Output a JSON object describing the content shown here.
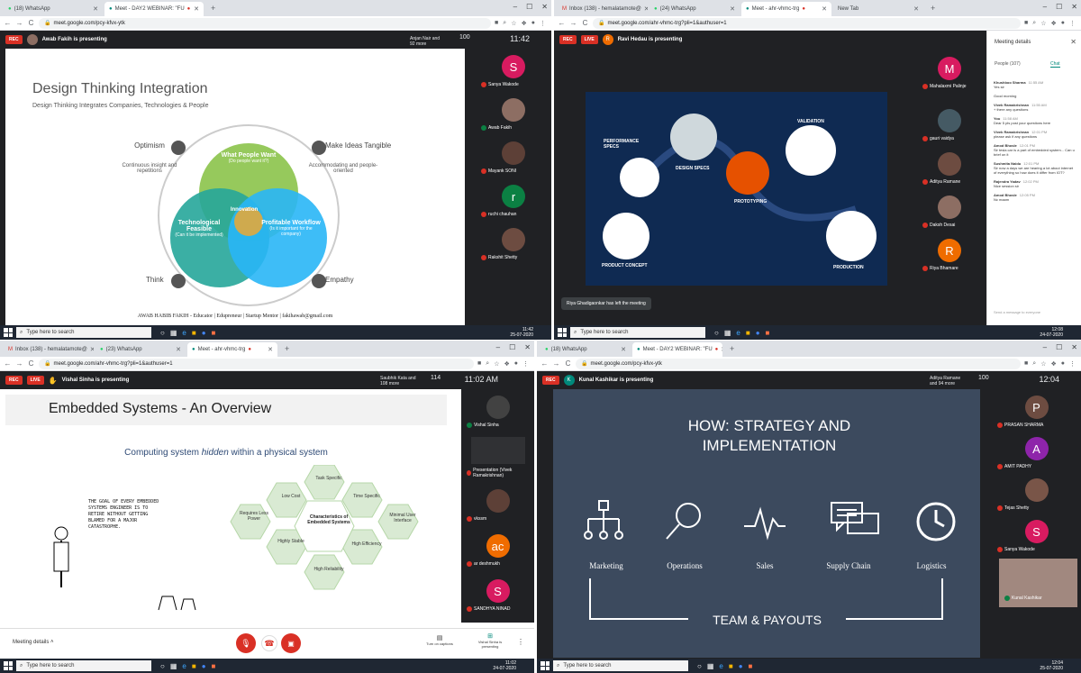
{
  "q1": {
    "tabs": [
      {
        "label": "(18) WhatsApp"
      },
      {
        "label": "Meet - DAY2 WEBINAR: \"FU"
      }
    ],
    "url": "meet.google.com/pcy-kfvx-ytk",
    "rec": "REC",
    "presenter": "Awab Fakih is presenting",
    "people": "Anjan Nair and 92 more",
    "count": "100",
    "time": "11:42",
    "you": "You",
    "slide": {
      "title": "Design Thinking Integration",
      "subtitle": "Design Thinking Integrates Companies, Technologies & People",
      "what": "What People Want",
      "what_sub": "(Do people want it?)",
      "tech": "Technological Feasible",
      "tech_sub": "(Can it be implemented)",
      "profit": "Profitable Workflow",
      "profit_sub": "(Is it important for the company)",
      "innov": "Innovation",
      "optimism": "Optimism",
      "optimism_sub": "Continuous insight and repetitions",
      "tangible": "Make Ideas Tangible",
      "tangible_sub": "Accommodating and people-oriented",
      "think": "Think",
      "empathy": "Empathy",
      "footer": "AWAB HABIB FAKIH - Educator | Edupreneur | Startup Mentor | fakihawab@gmail.com"
    },
    "participants": [
      {
        "name": "Sanya Wakode",
        "initial": "S",
        "color": "#d81b60"
      },
      {
        "name": "Awab Fakih",
        "initial": "",
        "color": "#8d6e63"
      },
      {
        "name": "Mayank SONI",
        "initial": "",
        "color": "#5d4037"
      },
      {
        "name": "ruchi chauhan",
        "initial": "r",
        "color": "#0b8043"
      },
      {
        "name": "Rakshit Shetty",
        "initial": "",
        "color": "#6d4c41"
      }
    ],
    "taskbar": {
      "search": "Type here to search",
      "time": "11:42",
      "date": "25-07-2020"
    }
  },
  "q2": {
    "tabs": [
      {
        "label": "Inbox (138) - hemalatamote@"
      },
      {
        "label": "(24) WhatsApp"
      },
      {
        "label": "Meet - ahr-vhmc-trg"
      },
      {
        "label": "New Tab"
      }
    ],
    "url": "meet.google.com/ahr-vhmc-trg?pli=1&authuser=1",
    "rec": "REC",
    "live": "LIVE",
    "presenter": "Ravi Hedau is presenting",
    "infographic": {
      "perf": "PERFORMANCE SPECS",
      "design": "DESIGN SPECS",
      "valid": "VALIDATION",
      "proto": "PROTOTYPING",
      "product": "PRODUCT CONCEPT",
      "production": "PRODUCTION"
    },
    "left_notice": "Riya Ghadigaonkar has left the meeting",
    "participants": [
      {
        "name": "Mahalaxmi Palinje",
        "initial": "M",
        "color": "#d81b60"
      },
      {
        "name": "gauri vaidya",
        "initial": "",
        "color": "#455a64"
      },
      {
        "name": "Aditya Ramane",
        "initial": "",
        "color": "#6d4c41"
      },
      {
        "name": "Daksh Desai",
        "initial": "",
        "color": "#8d6e63"
      },
      {
        "name": "Riya Bhamare",
        "initial": "R",
        "color": "#ef6c00"
      }
    ],
    "panel": {
      "title": "Meeting details",
      "people_tab": "People (107)",
      "chat_tab": "Chat",
      "messages": [
        {
          "who": "Khushboo Sharma",
          "time": "11:55 AM",
          "text": "Yes sir"
        },
        {
          "who": "",
          "time": "",
          "text": "Good morning"
        },
        {
          "who": "Vivek Ramakrishnan",
          "time": "11:55 AM",
          "text": "+ there any questions"
        },
        {
          "who": "You",
          "time": "11:58 AM",
          "text": "Dear 5 pls post your questions here"
        },
        {
          "who": "Vivek Ramakrishnan",
          "time": "12:01 PM",
          "text": "please ask if any questions"
        },
        {
          "who": "Amod Bhosle",
          "time": "12:01 PM",
          "text": "Sir tesla car is a part of embedded system... Can u brief on it"
        },
        {
          "who": "Sushmita Naidu",
          "time": "12:01 PM",
          "text": "Sir now a days we are hearing a lot about internet of everything so how does it differ from IOT?"
        },
        {
          "who": "Rajendra Yadav",
          "time": "12:02 PM",
          "text": "Nice session sir"
        },
        {
          "who": "Amod Bhosle",
          "time": "12:05 PM",
          "text": "Nc maam"
        }
      ],
      "input": "Send a message to everyone"
    },
    "taskbar": {
      "search": "Type here to search",
      "time": "12:08",
      "date": "24-07-2020"
    }
  },
  "q3": {
    "tabs": [
      {
        "label": "Inbox (138) - hemalatamote@"
      },
      {
        "label": "(23) WhatsApp"
      },
      {
        "label": "Meet - ahr-vhmc-trg"
      }
    ],
    "url": "meet.google.com/ahr-vhmc-trg?pli=1&authuser=1",
    "rec": "REC",
    "live": "LIVE",
    "presenter": "Vishal Sinha is presenting",
    "people": "Saubhik Kata and 108 more",
    "count": "114",
    "time": "11:02 AM",
    "slide": {
      "title": "Embedded Systems - An Overview",
      "subtitle_a": "Computing system ",
      "subtitle_b": "hidden",
      "subtitle_c": " within a physical system",
      "comic": "THE GOAL OF EVERY EMBEDDED SYSTEMS ENGINEER IS TO RETIRE WITHOUT GETTING BLAMED FOR A MAJOR CATASTROPHE.",
      "center": "Characteristics of Embedded Systems",
      "hexes": [
        "Task Specific",
        "Time Specific",
        "Minimal User Interface",
        "High Efficiency",
        "High Reliability",
        "Highly Stable",
        "Requires Less Power",
        "Low Cost"
      ]
    },
    "participants": [
      {
        "name": "Vishal Sinha",
        "initial": "",
        "color": "#424242"
      },
      {
        "name": "Presentation (Vivek Ramakrishnan)",
        "initial": "",
        "color": "#303134"
      },
      {
        "name": "vkssm",
        "initial": "",
        "color": "#5d4037"
      },
      {
        "name": "ar deshmukh",
        "initial": "ac",
        "color": "#ef6c00"
      },
      {
        "name": "SANDHYA NINAD",
        "initial": "S",
        "color": "#d81b60"
      }
    ],
    "bottom": {
      "details": "Meeting details",
      "captions": "Turn on captions",
      "presenting": "Vishal Sinha is presenting"
    },
    "taskbar": {
      "search": "Type here to search",
      "time": "11:02",
      "date": "24-07-2020"
    }
  },
  "q4": {
    "tabs": [
      {
        "label": "(18) WhatsApp"
      },
      {
        "label": "Meet - DAY2 WEBINAR: \"FU"
      }
    ],
    "url": "meet.google.com/pcy-kfvx-ytk",
    "rec": "REC",
    "presenter": "Kunal Kashikar is presenting",
    "people": "Aditya Ramane and 94 more",
    "count": "100",
    "time": "12:04",
    "slide": {
      "title": "HOW: STRATEGY AND IMPLEMENTATION",
      "items": [
        "Marketing",
        "Operations",
        "Sales",
        "Supply Chain",
        "Logistics"
      ],
      "bottom": "TEAM & PAYOUTS"
    },
    "participants": [
      {
        "name": "PRASAN SHARMA",
        "initial": "P",
        "color": "#6d4c41"
      },
      {
        "name": "AMIT PADHY",
        "initial": "A",
        "color": "#8e24aa"
      },
      {
        "name": "Tejas Shetty",
        "initial": "",
        "color": "#795548"
      },
      {
        "name": "Sanya Wakode",
        "initial": "S",
        "color": "#d81b60"
      },
      {
        "name": "Kunal Kashikar",
        "initial": "",
        "color": "#a1887f"
      }
    ],
    "taskbar": {
      "search": "Type here to search",
      "time": "12:04",
      "date": "25-07-2020"
    }
  }
}
